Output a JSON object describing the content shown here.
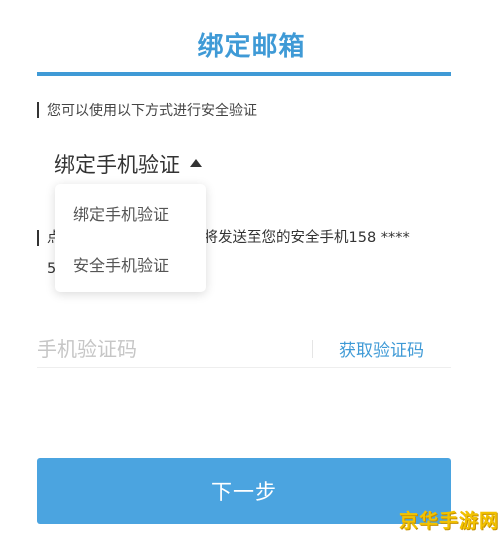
{
  "header": {
    "title": "绑定邮箱"
  },
  "verify": {
    "info": "您可以使用以下方式进行安全验证",
    "selected_method": "绑定手机验证",
    "hint_prefix": "点",
    "hint_visible": "将发送至您的安全手机158 ****",
    "hint_line2_prefix": "5"
  },
  "dropdown": {
    "options": [
      "绑定手机验证",
      "安全手机验证"
    ]
  },
  "code": {
    "placeholder": "手机验证码",
    "get_code_label": "获取验证码"
  },
  "actions": {
    "next_label": "下一步"
  },
  "watermark": {
    "text": "京华手游网"
  },
  "colors": {
    "accent": "#3f9ad6",
    "button": "#4ba4e0",
    "watermark": "#f2c200"
  }
}
